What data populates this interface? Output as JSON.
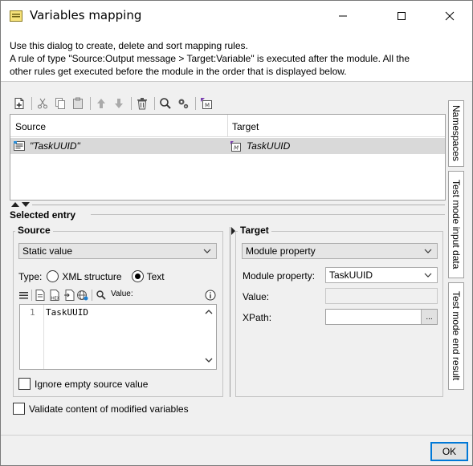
{
  "window": {
    "title": "Variables mapping",
    "description_line1": "Use this dialog to create, delete and sort mapping rules.",
    "description_line2": "A rule of type \"Source:Output message > Target:Variable\" is executed after the module. All the",
    "description_line3": "other rules get executed before the module in the order that is displayed below."
  },
  "toolbar": {
    "icons": [
      "new-rule-icon",
      "cut-icon",
      "copy-icon",
      "paste-icon",
      "move-up-icon",
      "move-down-icon",
      "delete-icon",
      "search-icon",
      "settings-icon",
      "module-icon"
    ]
  },
  "grid": {
    "columns": [
      "Source",
      "Target"
    ],
    "rows": [
      {
        "source": "\"TaskUUID\"",
        "target": "TaskUUID"
      }
    ]
  },
  "selected_entry": {
    "label": "Selected entry",
    "source": {
      "title": "Source",
      "type_selected": "Static value",
      "type_label": "Type:",
      "radio_xml": "XML structure",
      "radio_text": "Text",
      "radio_selected": "Text",
      "value_label": "Value:",
      "line_number": "1",
      "code": "TaskUUID",
      "ignore_empty_label": "Ignore empty source value",
      "ignore_empty_checked": false
    },
    "target": {
      "title": "Target",
      "type_selected": "Module property",
      "module_property_label": "Module property:",
      "module_property_value": "TaskUUID",
      "value_label": "Value:",
      "xpath_label": "XPath:",
      "xpath_button": "..."
    }
  },
  "validate_label": "Validate content of modified variables",
  "validate_checked": false,
  "side_tabs": [
    "Namespaces",
    "Test mode input data",
    "Test mode end result"
  ],
  "ok_label": "OK"
}
